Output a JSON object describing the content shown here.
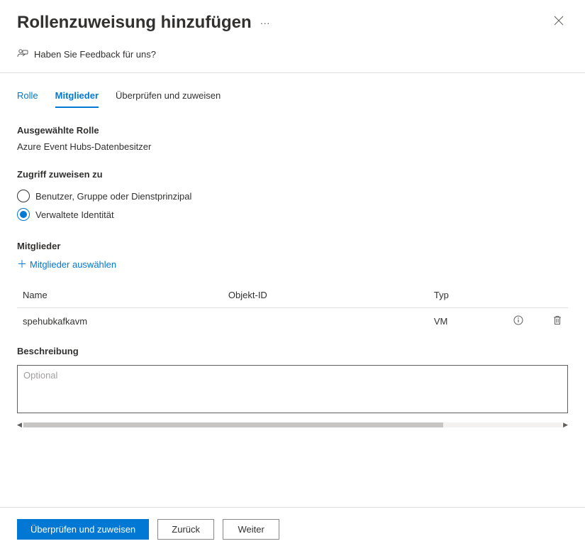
{
  "header": {
    "title": "Rollenzuweisung hinzufügen"
  },
  "feedback": {
    "label": "Haben Sie Feedback für uns?"
  },
  "tabs": {
    "role": "Rolle",
    "members": "Mitglieder",
    "review": "Überprüfen und zuweisen"
  },
  "selectedRole": {
    "label": "Ausgewählte Rolle",
    "value": "Azure Event Hubs-Datenbesitzer"
  },
  "assignAccess": {
    "label": "Zugriff zuweisen zu",
    "options": {
      "userGroup": "Benutzer, Gruppe oder Dienstprinzipal",
      "managedIdentity": "Verwaltete Identität"
    }
  },
  "members": {
    "label": "Mitglieder",
    "addLink": "Mitglieder auswählen",
    "columns": {
      "name": "Name",
      "objectId": "Objekt-ID",
      "type": "Typ"
    },
    "rows": [
      {
        "name": "spehubkafkavm",
        "objectId": "",
        "type": "VM"
      }
    ]
  },
  "description": {
    "label": "Beschreibung",
    "placeholder": "Optional",
    "value": ""
  },
  "footer": {
    "primary": "Überprüfen und zuweisen",
    "back": "Zurück",
    "next": "Weiter"
  }
}
